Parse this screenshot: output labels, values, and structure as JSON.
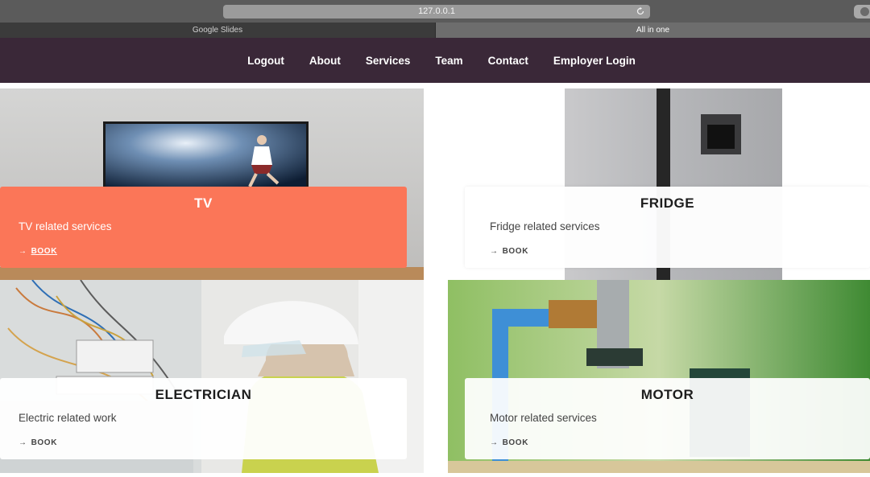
{
  "browser": {
    "url": "127.0.0.1",
    "tabs": [
      "Google Slides",
      "All in one"
    ]
  },
  "nav": {
    "links": [
      "Logout",
      "About",
      "Services",
      "Team",
      "Contact",
      "Employer Login"
    ]
  },
  "services": [
    {
      "title": "TV",
      "description": "TV related services",
      "action": "BOOK"
    },
    {
      "title": "FRIDGE",
      "description": "Fridge related services",
      "action": "BOOK"
    },
    {
      "title": "ELECTRICIAN",
      "description": "Electric related work",
      "action": "BOOK"
    },
    {
      "title": "MOTOR",
      "description": "Motor related services",
      "action": "BOOK"
    }
  ],
  "icons": {
    "book_arrow": "→",
    "reload": "reload-icon"
  },
  "colors": {
    "nav_bg": "#3a2838",
    "tv_card": "#fb7658",
    "chrome": "#5b5b5b"
  }
}
